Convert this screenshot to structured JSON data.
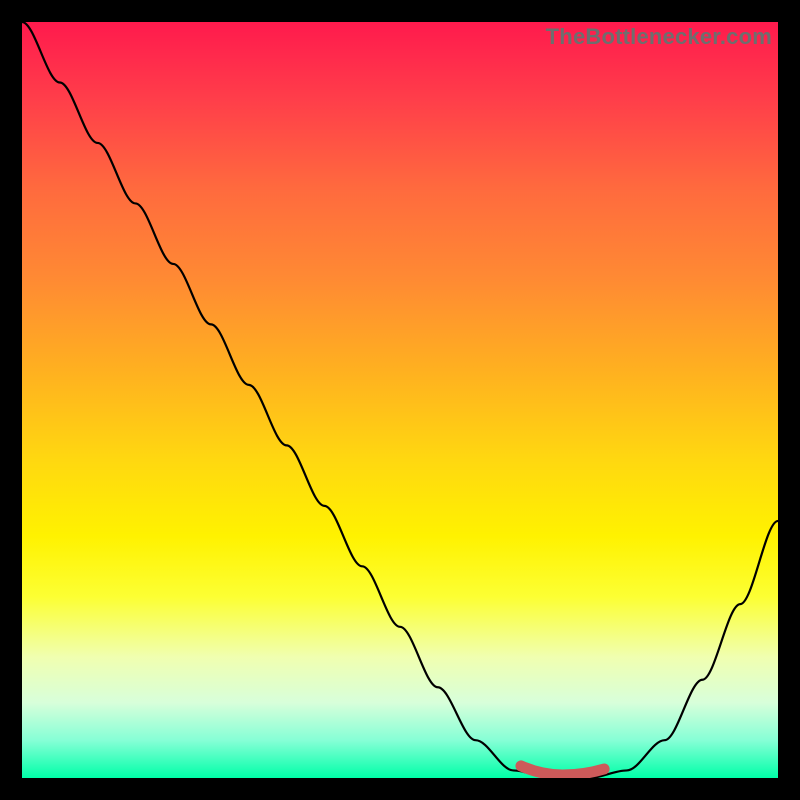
{
  "source_label": "TheBottlenecker.com",
  "chart_data": {
    "type": "line",
    "title": "",
    "xlabel": "",
    "ylabel": "",
    "xlim": [
      0,
      100
    ],
    "ylim": [
      0,
      100
    ],
    "x": [
      0,
      5,
      10,
      15,
      20,
      25,
      30,
      35,
      40,
      45,
      50,
      55,
      60,
      65,
      70,
      75,
      80,
      85,
      90,
      95,
      100
    ],
    "values": [
      100,
      92,
      84,
      76,
      68,
      60,
      52,
      44,
      36,
      28,
      20,
      12,
      5,
      1,
      0,
      0,
      1,
      5,
      13,
      23,
      34
    ],
    "flat_region_x": [
      66,
      77
    ],
    "marker_color": "#cc5a5a",
    "curve_color": "#000000"
  }
}
